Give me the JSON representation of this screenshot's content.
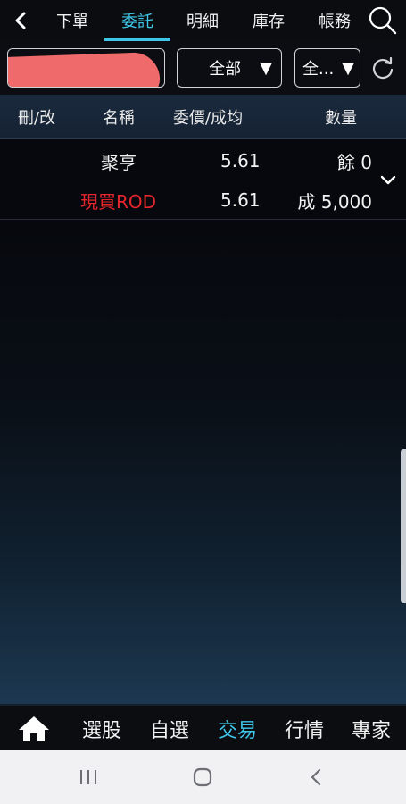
{
  "nav": {
    "tabs": [
      {
        "label": "下單"
      },
      {
        "label": "委託"
      },
      {
        "label": "明細"
      },
      {
        "label": "庫存"
      },
      {
        "label": "帳務"
      }
    ],
    "active_tab": "委託"
  },
  "filters": {
    "status_select": "全部",
    "type_select": "全..."
  },
  "table": {
    "headers": [
      "刪/改",
      "名稱",
      "委價/成均",
      "數量"
    ],
    "rows": [
      {
        "name": "聚亨",
        "price": "5.61",
        "qty": "餘 0",
        "order_type": "現買ROD",
        "avg_price": "5.61",
        "filled": "成 5,000"
      }
    ]
  },
  "bottom_nav": {
    "items": [
      {
        "label": "選股"
      },
      {
        "label": "自選"
      },
      {
        "label": "交易"
      },
      {
        "label": "行情"
      },
      {
        "label": "專家"
      }
    ],
    "active": "交易"
  },
  "colors": {
    "accent": "#3fc6e8",
    "buy_red": "#e4262d",
    "background": "#06080d"
  },
  "icons": [
    "back-arrow-icon",
    "search-icon",
    "refresh-icon",
    "chevron-down-icon",
    "home-icon",
    "recent-apps-icon",
    "home-circle-icon",
    "system-back-icon"
  ]
}
